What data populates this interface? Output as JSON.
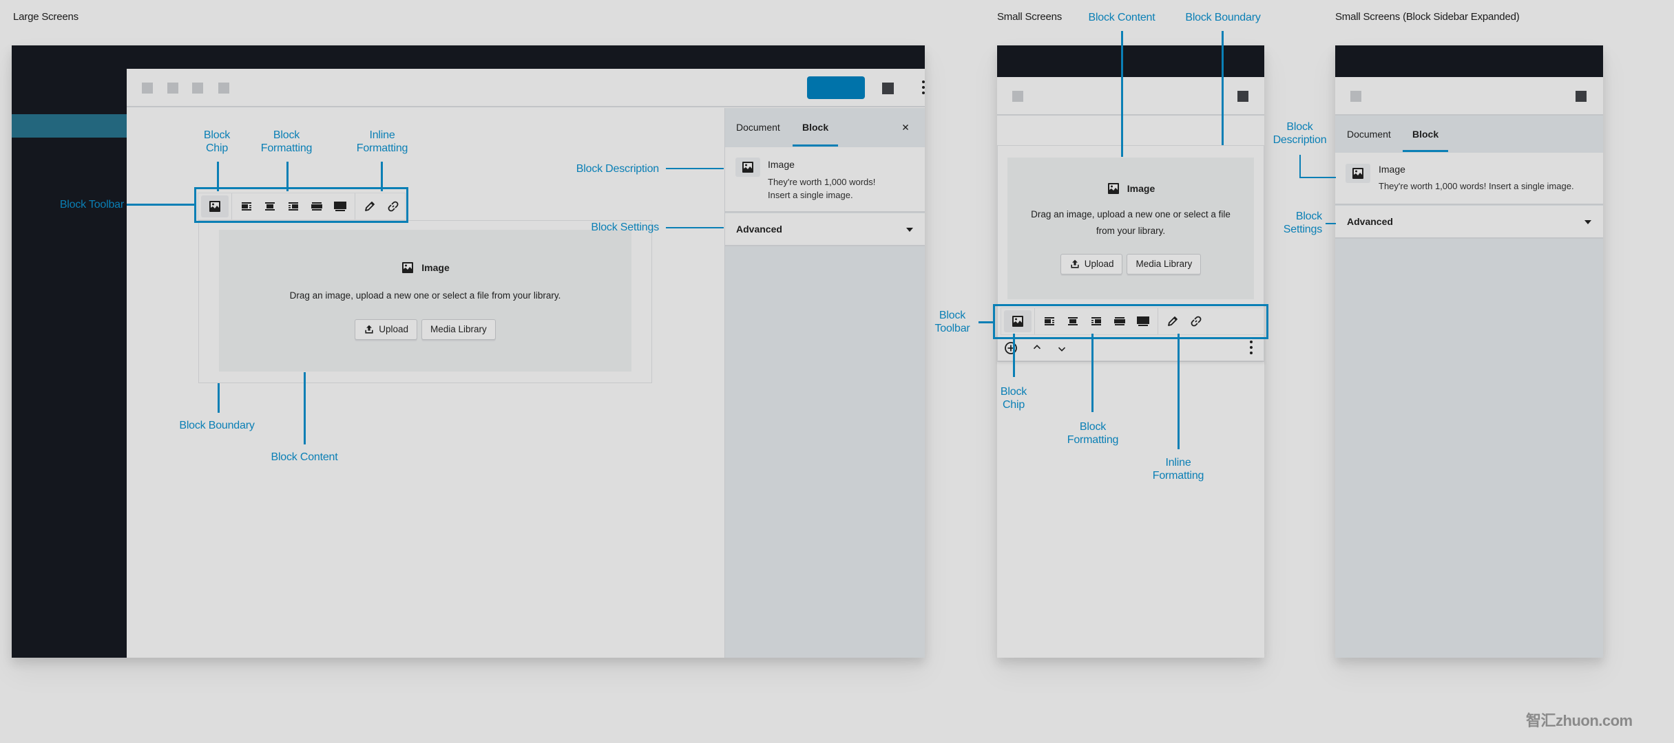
{
  "sections": {
    "large": "Large Screens",
    "small": "Small Screens",
    "small_expanded": "Small Screens (Block Sidebar Expanded)"
  },
  "annotations": {
    "block_chip": "Block\nChip",
    "block_formatting": "Block\nFormatting",
    "inline_formatting": "Inline\nFormatting",
    "block_toolbar": "Block Toolbar",
    "block_toolbar_stacked": "Block\nToolbar",
    "block_description": "Block Description",
    "block_description_stacked": "Block\nDescription",
    "block_settings": "Block Settings",
    "block_settings_stacked": "Block\nSettings",
    "block_boundary": "Block Boundary",
    "block_content": "Block Content"
  },
  "colors": {
    "accent": "#0a7fb5",
    "publish": "#0073aa",
    "admin_bar": "#14171e",
    "admin_active": "#23667d",
    "canvas": "#dddddd",
    "sidebar": "#caced1"
  },
  "sidebar": {
    "tabs": [
      {
        "label": "Document",
        "active": false
      },
      {
        "label": "Block",
        "active": true
      }
    ],
    "close_icon": "close-icon",
    "block_name": "Image",
    "block_description": "They're worth 1,000 words! Insert a single image.",
    "block_description_line1": "They're worth 1,000 words!",
    "block_description_line2": "Insert a single image.",
    "advanced_label": "Advanced"
  },
  "image_block": {
    "title": "Image",
    "instructions": "Drag an image, upload a new one or select a file from your library.",
    "instructions_line1": "Drag an image, upload a new one or select a file",
    "instructions_line2": "from your library.",
    "upload_label": "Upload",
    "media_library_label": "Media Library"
  },
  "toolbar": {
    "chip": "image-icon",
    "block_formatting": [
      "align-left-icon",
      "align-center-icon",
      "align-right-icon",
      "wide-width-icon",
      "full-width-icon"
    ],
    "inline_formatting": [
      "edit-icon",
      "link-icon"
    ]
  },
  "mobile_controls": [
    "add-block-icon",
    "move-up-icon",
    "move-down-icon",
    "more-options-icon"
  ],
  "watermark": "智汇zhuon.com"
}
